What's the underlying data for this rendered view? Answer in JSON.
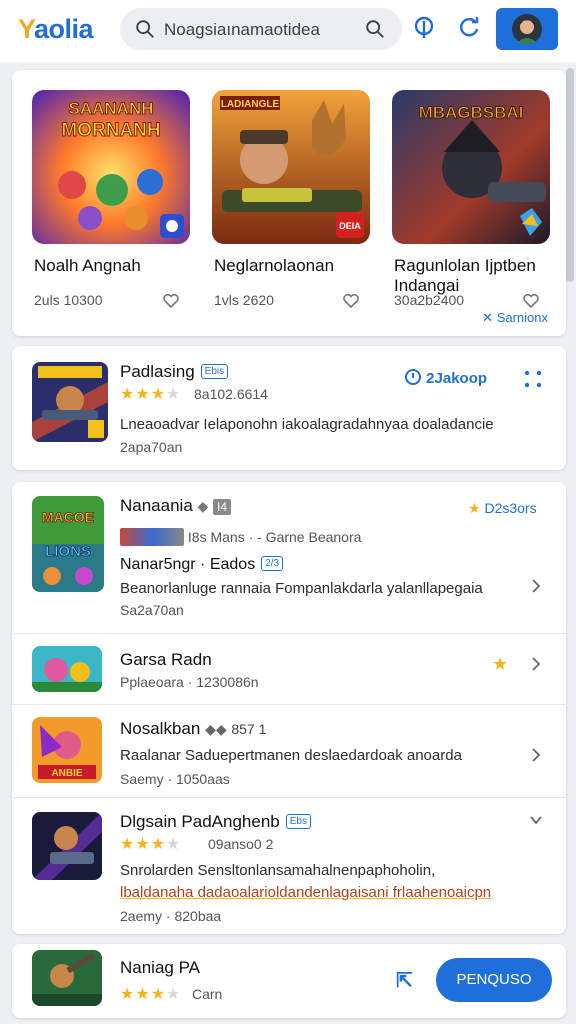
{
  "header": {
    "logo_part1": "Y",
    "logo_part2": "aolia",
    "search_text": "Noagsiaınamaotidea"
  },
  "featured": {
    "items": [
      {
        "title": "Noalh Angnah",
        "meta": "2uls 10300",
        "art_text": "SAANANH MORNANH"
      },
      {
        "title": "Neglarnolaonan",
        "meta": "1vls 2620",
        "art_text": "LADIANGLE",
        "art_badge": "DEIA"
      },
      {
        "title": "Ragunlolan Ijptben Indangai",
        "meta": "30a2b2400",
        "art_text": "MBAGBSBAI"
      }
    ],
    "see_more": "Sarnionx"
  },
  "spotlight": {
    "title": "Padlasing",
    "badge": "Ebis",
    "rating_text": "8a102.6614",
    "action": "2Jakoop",
    "description": "Lneaoadvar Ielaponohn iakoalagradahnyaa doaladancie",
    "sub": "2apa70an"
  },
  "list": {
    "items": [
      {
        "title": "Nanaania",
        "tag": "I4",
        "category": "I8s Mans · -  Garne Beanora",
        "featured_label": "D2s3ors",
        "subtitle": "Nanar5ngr · Eados",
        "sub_badge": "2/3",
        "description": "Beanorlanluge rannaia Fompanlakdarla yalanllapegaia",
        "sub": "Sa2a70an",
        "art_text": "MACOE LIONS"
      },
      {
        "title": "Garsa Radn",
        "sub": "Pplaeoara · 1230086n"
      },
      {
        "title": "Nosalkban",
        "tag": "857 1",
        "description": "Raalanar Saduepertmanen deslaedardoak anoarda",
        "sub": "Saemy · 1050aas",
        "art_text": "ANBIE"
      },
      {
        "title": "Dlgsain PadAnghenb",
        "badge": "Ebs",
        "rating_text": "09anso0 2",
        "description": "Snrolarden Sensltonlansamahalnenpaphoholin,",
        "description2": "lbaldanaha dadaoalarioldandenlagaisani frlaahenoaicpn",
        "sub": "2aemy · 820baa"
      }
    ]
  },
  "bottom": {
    "title": "Naniag PA",
    "sub": "Carn",
    "install_label": "PENQUSO"
  },
  "colors": {
    "accent": "#1e6fd9",
    "star": "#f3b41a",
    "logo_yellow": "#f5a623"
  }
}
